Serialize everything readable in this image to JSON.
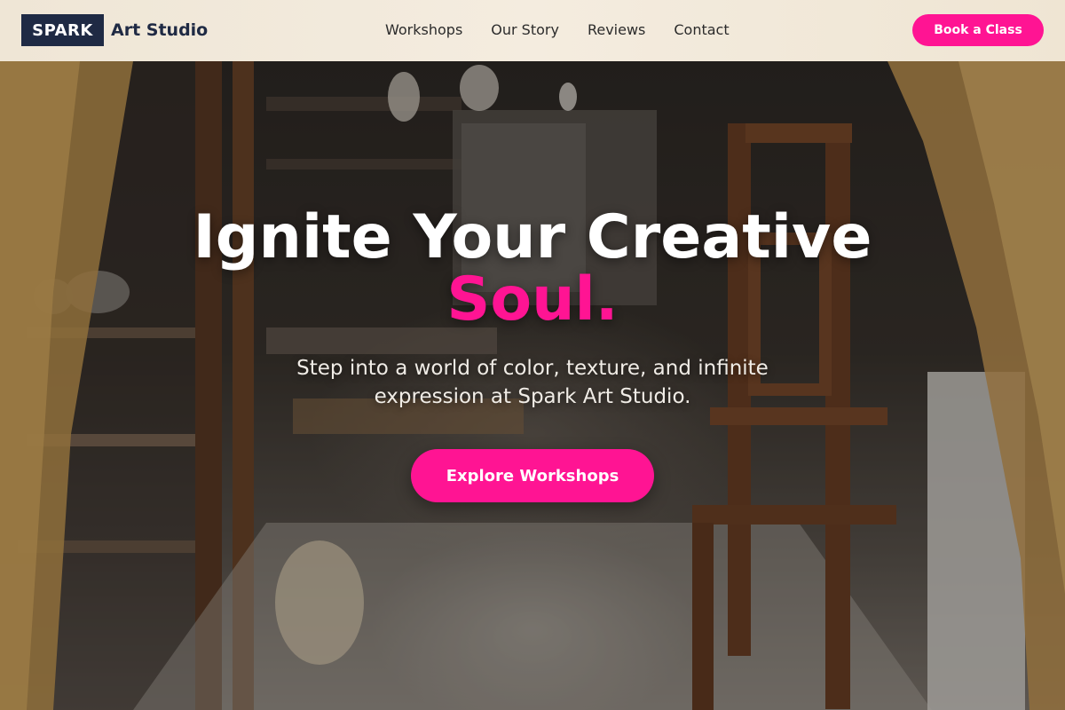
{
  "header": {
    "logo_box": "SPARK",
    "logo_text": "Art Studio",
    "nav": [
      "Workshops",
      "Our Story",
      "Reviews",
      "Contact"
    ],
    "cta_label": "Book a Class"
  },
  "hero": {
    "title_line1": "Ignite Your Creative",
    "title_line2": "Soul.",
    "subtitle": "Step into a world of color, texture, and infinite expression at Spark Art Studio.",
    "cta_label": "Explore Workshops",
    "background_image": "art-studio-interior-photo"
  },
  "colors": {
    "accent": "#ff1493",
    "navy": "#1f2a44",
    "header_bg": "#f1e8d9"
  }
}
